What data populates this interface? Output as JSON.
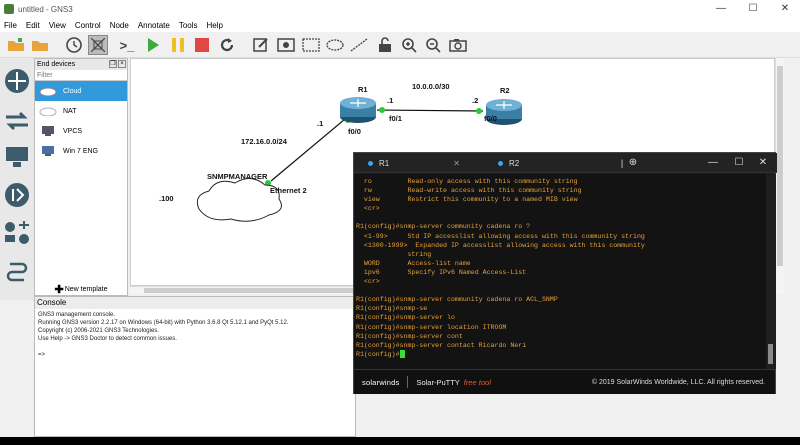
{
  "window": {
    "title": "untitled - GNS3",
    "minimize": "—",
    "maximize": "☐",
    "close": "✕"
  },
  "menu": [
    "File",
    "Edit",
    "View",
    "Control",
    "Node",
    "Annotate",
    "Tools",
    "Help"
  ],
  "toolbar_icons": [
    "folder-new-icon",
    "folder-open-icon",
    "snapshot-clock-icon",
    "grid-icon",
    "console-all-icon",
    "start-icon",
    "pause-icon",
    "stop-icon",
    "reload-icon",
    "edit-note-icon",
    "insert-picture-icon",
    "rectangle-icon",
    "ellipse-icon",
    "line-icon",
    "lock-icon",
    "zoom-in-icon",
    "zoom-out-icon",
    "screenshot-icon"
  ],
  "device_panel": {
    "title": "End devices",
    "filter_placeholder": "Filter",
    "devices": [
      {
        "label": "Cloud",
        "selected": true
      },
      {
        "label": "NAT",
        "selected": false
      },
      {
        "label": "VPCS",
        "selected": false
      },
      {
        "label": "Win 7 ENG",
        "selected": false
      }
    ],
    "new_template": "New template"
  },
  "topology": {
    "r1_label": "R1",
    "r2_label": "R2",
    "cloud_label": "SNMPMANAGER",
    "link_r1_r2_subnet": "10.0.0.0/30",
    "r1_f01_ip": ".1",
    "r1_f01_port": "f0/1",
    "r2_ip": ".2",
    "r2_port": "f0/0",
    "link_r1_cloud_subnet": "172.16.0.0/24",
    "r1_f00_ip": ".1",
    "r1_f00_port": "f0/0",
    "cloud_port": "Ethernet 2",
    "cloud_ip": ".100",
    "link_color": "#22cc33"
  },
  "console": {
    "title": "Console",
    "lines": [
      "GNS3 management console.",
      "Running GNS3 version 2.2.17 on Windows (64-bit) with Python 3.6.8 Qt 5.12.1 and PyQt 5.12.",
      "Copyright (c) 2006-2021 GNS3 Technologies.",
      "Use Help -> GNS3 Doctor to detect common issues.",
      "",
      "=>"
    ]
  },
  "putty": {
    "tabs": [
      {
        "label": "R1",
        "active": true
      },
      {
        "label": "R2",
        "active": false
      }
    ],
    "new_tab": "⊕",
    "terminal_lines": [
      "  ro         Read-only access with this community string",
      "  rw         Read-write access with this community string",
      "  view       Restrict this community to a named MIB view",
      "  <cr>",
      "",
      "R1(config)#snmp-server community cadena ro ?",
      "  <1-99>     Std IP accesslist allowing access with this community string",
      "  <1300-1999>  Expanded IP accesslist allowing access with this community",
      "             string",
      "  WORD       Access-list name",
      "  ipv6       Specify IPv6 Named Access-List",
      "  <cr>",
      "",
      "R1(config)#snmp-server community cadena ro ACL_SNMP",
      "R1(config)#snmp-se",
      "R1(config)#snmp-server lo",
      "R1(config)#snmp-server location ITROOM",
      "R1(config)#snmp-server cont",
      "R1(config)#snmp-server contact Ricardo Neri",
      "R1(config)#"
    ],
    "footer_brand": "solarwinds",
    "footer_product": "Solar-PuTTY",
    "footer_tag": "free tool",
    "footer_copyright": "© 2019 SolarWinds Worldwide, LLC. All rights reserved.",
    "accent": "#3da4f0",
    "terminal_text_color": "#e6a13a",
    "cursor_color": "#3ddc3d"
  }
}
